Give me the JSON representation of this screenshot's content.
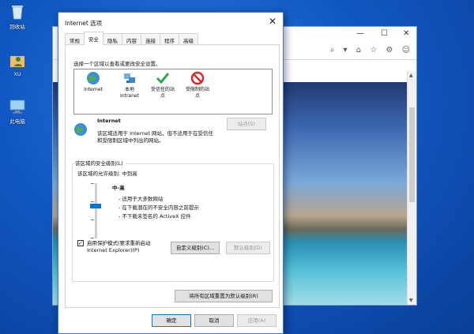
{
  "desktop": {
    "icons": [
      {
        "label": "回收站",
        "icon": "recycle-bin-icon"
      },
      {
        "label": "XU",
        "icon": "user-folder-icon"
      },
      {
        "label": "此电脑",
        "icon": "computer-icon"
      }
    ]
  },
  "browser": {
    "controls": {
      "minimize": "—",
      "maximize": "☐",
      "close": "✕"
    },
    "addr_icons": "⌕ ▾ ⌂ ☆ ⚙ ☺"
  },
  "dialog": {
    "title": "Internet 选项",
    "close": "✕",
    "tabs": [
      "常规",
      "安全",
      "隐私",
      "内容",
      "连接",
      "程序",
      "高级"
    ],
    "active_tab": "安全",
    "zone_prompt": "选择一个区域以查看或更改安全设置。",
    "zones": [
      {
        "label": "Internet",
        "icon": "globe-icon",
        "selected": true
      },
      {
        "label": "本地\nIntranet",
        "icon": "intranet-icon"
      },
      {
        "label": "受信任的站\n点",
        "icon": "checkmark-icon"
      },
      {
        "label": "受限制的站\n点",
        "icon": "restricted-icon"
      }
    ],
    "zone_title": "Internet",
    "zone_desc": "该区域适用于 Internet 网站，但不适用于在受信任\n和受限制区域中列出的网站。",
    "sites_button": "站点(S)",
    "security_level_title": "该区域的安全级别(L)",
    "allowed_levels": "该区域的允许级别: 中到高",
    "level_name": "中-高",
    "level_bullets": [
      "- 适用于大多数网站",
      "- 在下载潜在的不安全内容之前提示",
      "- 不下载未签名的 ActiveX 控件"
    ],
    "protected_mode": "启用保护模式(要求重新启动\nInternet Explorer)(P)",
    "protected_mode_checked": "✓",
    "custom_level_button": "自定义级别(C)...",
    "default_level_button": "默认级别(D)",
    "reset_all_button": "将所有区域重置为默认级别(R)",
    "ok_button": "确定",
    "cancel_button": "取消",
    "apply_button": "应用(A)"
  }
}
